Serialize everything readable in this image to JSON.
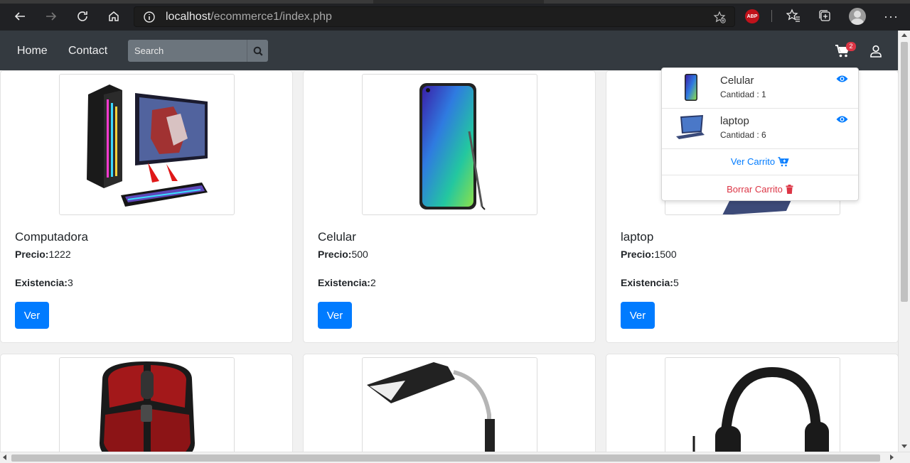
{
  "browser": {
    "url_host": "localhost",
    "url_path": "/ecommerce1/index.php",
    "abp_label": "ABP"
  },
  "nav": {
    "home_label": "Home",
    "contact_label": "Contact",
    "search_placeholder": "Search",
    "cart_count": "2"
  },
  "products": [
    {
      "name": "Computadora",
      "price_label": "Precio:",
      "price": "1222",
      "stock_label": "Existencia:",
      "stock": "3",
      "button": "Ver"
    },
    {
      "name": "Celular",
      "price_label": "Precio:",
      "price": "500",
      "stock_label": "Existencia:",
      "stock": "2",
      "button": "Ver"
    },
    {
      "name": "laptop",
      "price_label": "Precio:",
      "price": "1500",
      "stock_label": "Existencia:",
      "stock": "5",
      "button": "Ver"
    }
  ],
  "cart_dropdown": {
    "items": [
      {
        "name": "Celular",
        "qty": "Cantidad : 1"
      },
      {
        "name": "laptop",
        "qty": "Cantidad : 6"
      }
    ],
    "view_cart": "Ver Carrito",
    "clear_cart": "Borrar Carrito"
  },
  "colors": {
    "primary": "#007bff",
    "danger": "#dc3545",
    "navbar": "#343a40",
    "browser_chrome": "#202124"
  }
}
